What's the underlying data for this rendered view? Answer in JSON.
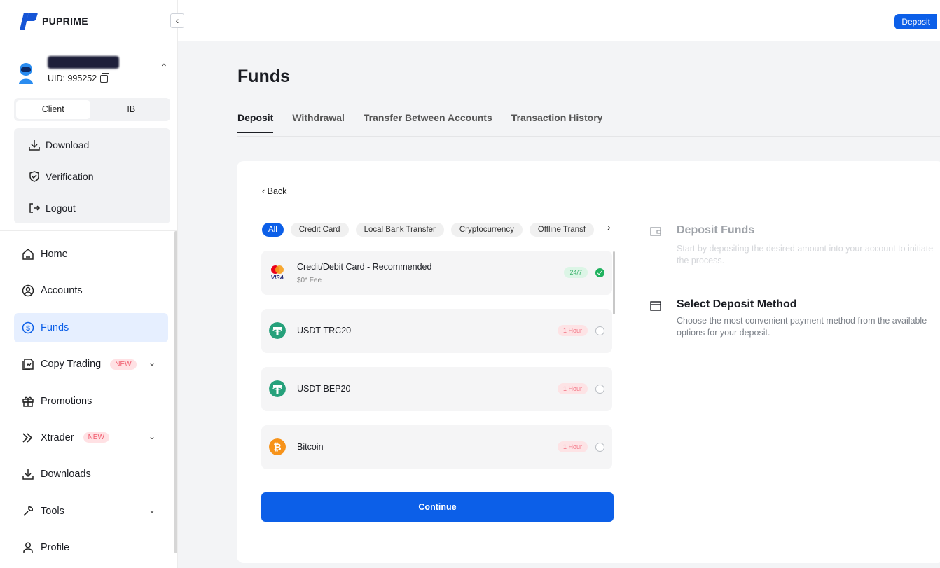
{
  "brand": {
    "name": "PUPRIME"
  },
  "user": {
    "uid_label": "UID: 995252"
  },
  "roles": [
    "Client",
    "IB"
  ],
  "user_menu": [
    {
      "label": "Download",
      "icon": "download-icon"
    },
    {
      "label": "Verification",
      "icon": "shield-check-icon"
    },
    {
      "label": "Logout",
      "icon": "logout-icon"
    }
  ],
  "nav": [
    {
      "label": "Home",
      "icon": "home-icon"
    },
    {
      "label": "Accounts",
      "icon": "accounts-icon"
    },
    {
      "label": "Funds",
      "icon": "dollar-circle-icon",
      "active": true
    },
    {
      "label": "Copy Trading",
      "icon": "copy-trading-icon",
      "badge": "NEW",
      "expandable": true
    },
    {
      "label": "Promotions",
      "icon": "gift-icon"
    },
    {
      "label": "Xtrader",
      "icon": "xtrader-icon",
      "badge": "NEW",
      "expandable": true
    },
    {
      "label": "Downloads",
      "icon": "download-icon"
    },
    {
      "label": "Tools",
      "icon": "wrench-icon",
      "expandable": true
    },
    {
      "label": "Profile",
      "icon": "profile-icon"
    }
  ],
  "topbar": {
    "deposit_label": "Deposit"
  },
  "page": {
    "title": "Funds"
  },
  "tabs": [
    "Deposit",
    "Withdrawal",
    "Transfer Between Accounts",
    "Transaction History"
  ],
  "back_label": "Back",
  "filters": [
    "All",
    "Credit Card",
    "Local Bank Transfer",
    "Cryptocurrency",
    "Offline Transf"
  ],
  "methods": [
    {
      "name": "Credit/Debit Card - Recommended",
      "fee": "$0* Fee",
      "tag": "24/7",
      "tag_color": "green",
      "selected": true,
      "icon": "card-brands-icon"
    },
    {
      "name": "USDT-TRC20",
      "fee": "",
      "tag": "1 Hour",
      "tag_color": "red",
      "selected": false,
      "icon": "tether-icon"
    },
    {
      "name": "USDT-BEP20",
      "fee": "",
      "tag": "1 Hour",
      "tag_color": "red",
      "selected": false,
      "icon": "tether-icon"
    },
    {
      "name": "Bitcoin",
      "fee": "",
      "tag": "1 Hour",
      "tag_color": "red",
      "selected": false,
      "icon": "bitcoin-icon"
    }
  ],
  "continue_label": "Continue",
  "steps": [
    {
      "title": "Deposit Funds",
      "desc": "Start by depositing the desired amount into your account to initiate the process."
    },
    {
      "title": "Select Deposit Method",
      "desc": "Choose the most convenient payment method from the available options for your deposit."
    }
  ],
  "colors": {
    "accent": "#0c5fe8",
    "success": "#21b25f",
    "badge_red": "#f05a6c"
  }
}
